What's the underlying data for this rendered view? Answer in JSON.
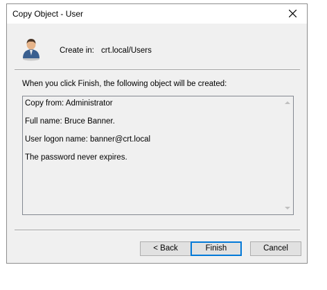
{
  "window": {
    "title": "Copy Object - User"
  },
  "header": {
    "icon": "user-icon",
    "create_in_label": "Create in:",
    "create_in_value": "crt.local/Users"
  },
  "main": {
    "info_text": "When you click Finish, the following object will be created:",
    "summary_lines": [
      "Copy from: Administrator",
      "Full name: Bruce Banner.",
      "User logon name: banner@crt.local",
      "The password never expires."
    ]
  },
  "buttons": {
    "back": "< Back",
    "finish": "Finish",
    "cancel": "Cancel"
  },
  "colors": {
    "accent": "#0078d7",
    "dialog_bg": "#f0f0f0",
    "titlebar_bg": "#ffffff"
  }
}
